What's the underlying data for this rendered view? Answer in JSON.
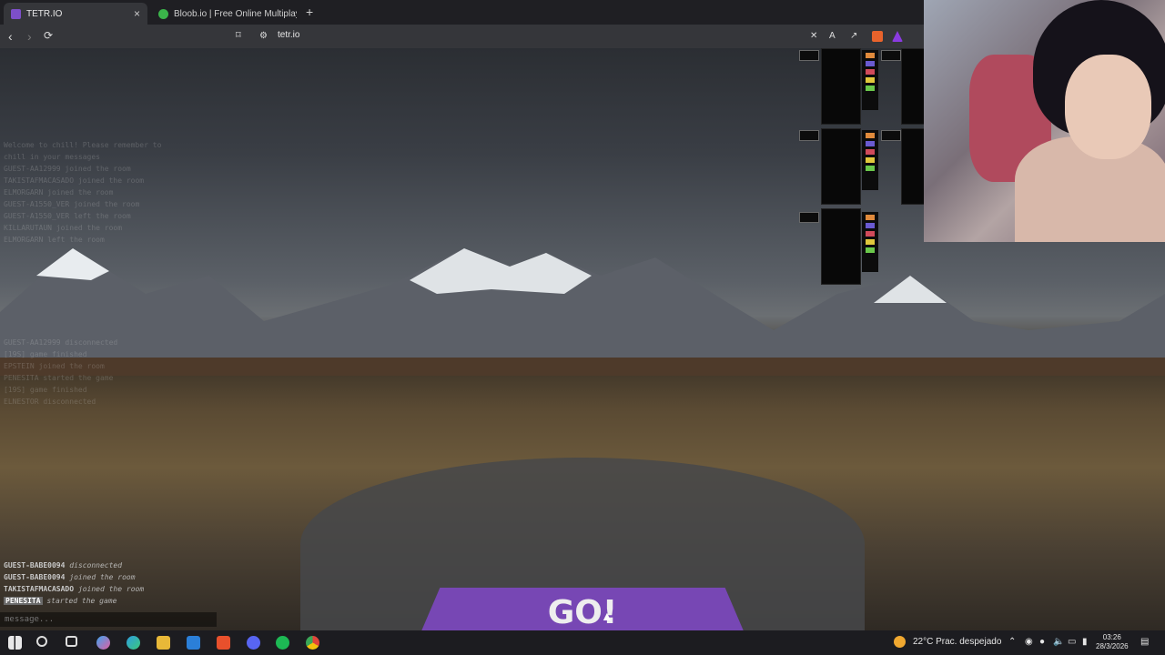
{
  "browser": {
    "tabs": [
      {
        "label": "TETR.IO",
        "active": true
      },
      {
        "label": "Bloob.io | Free Online Multiplayer Ga",
        "active": false
      }
    ],
    "url": "tetr.io",
    "new_tab": "+",
    "close_icon": "×"
  },
  "game": {
    "chat_faded": [
      "Welcome to chill! Please remember to",
      "chill in your messages",
      "GUEST-AA12999  joined the room",
      "TAKISTAFMACASADO  joined the room",
      "ELMORGARN  joined the room",
      "GUEST-A1550_VER  joined the room",
      "GUEST-A1550_VER  left the room",
      "KILLARUTAUN  joined the room",
      "ELMORGARN  left the room",
      "GUEST-AA12999  disconnected",
      "[19S]  game finished",
      "EPSTEIN  joined the room",
      "PENESITA  started the game",
      "[19S]  game finished",
      "ELNESTOR  disconnected"
    ],
    "chat_visible": [
      {
        "name": "GUEST-BABE0094",
        "event": "disconnected"
      },
      {
        "name": "GUEST-BABE0094",
        "event": "joined the room"
      },
      {
        "name": "TAKISTAFMACASADO",
        "event": "joined the room"
      },
      {
        "name": "PENESITA",
        "event": "started the game"
      }
    ],
    "message_placeholder": "message...",
    "go_label": "GO!",
    "opponent_boards": 3
  },
  "taskbar": {
    "weather": "22°C  Prac. despejado",
    "time": "03:26",
    "date": "28/3/2026",
    "icons": [
      "windows-icon",
      "search-icon",
      "task-view-icon",
      "copilot-icon",
      "edge-icon",
      "file-explorer-icon",
      "store-icon",
      "brave-icon",
      "discord-icon",
      "spotify-icon",
      "chrome-icon"
    ]
  },
  "colors": {
    "go_button": "#8048c8",
    "browser_bg": "#35363a"
  }
}
